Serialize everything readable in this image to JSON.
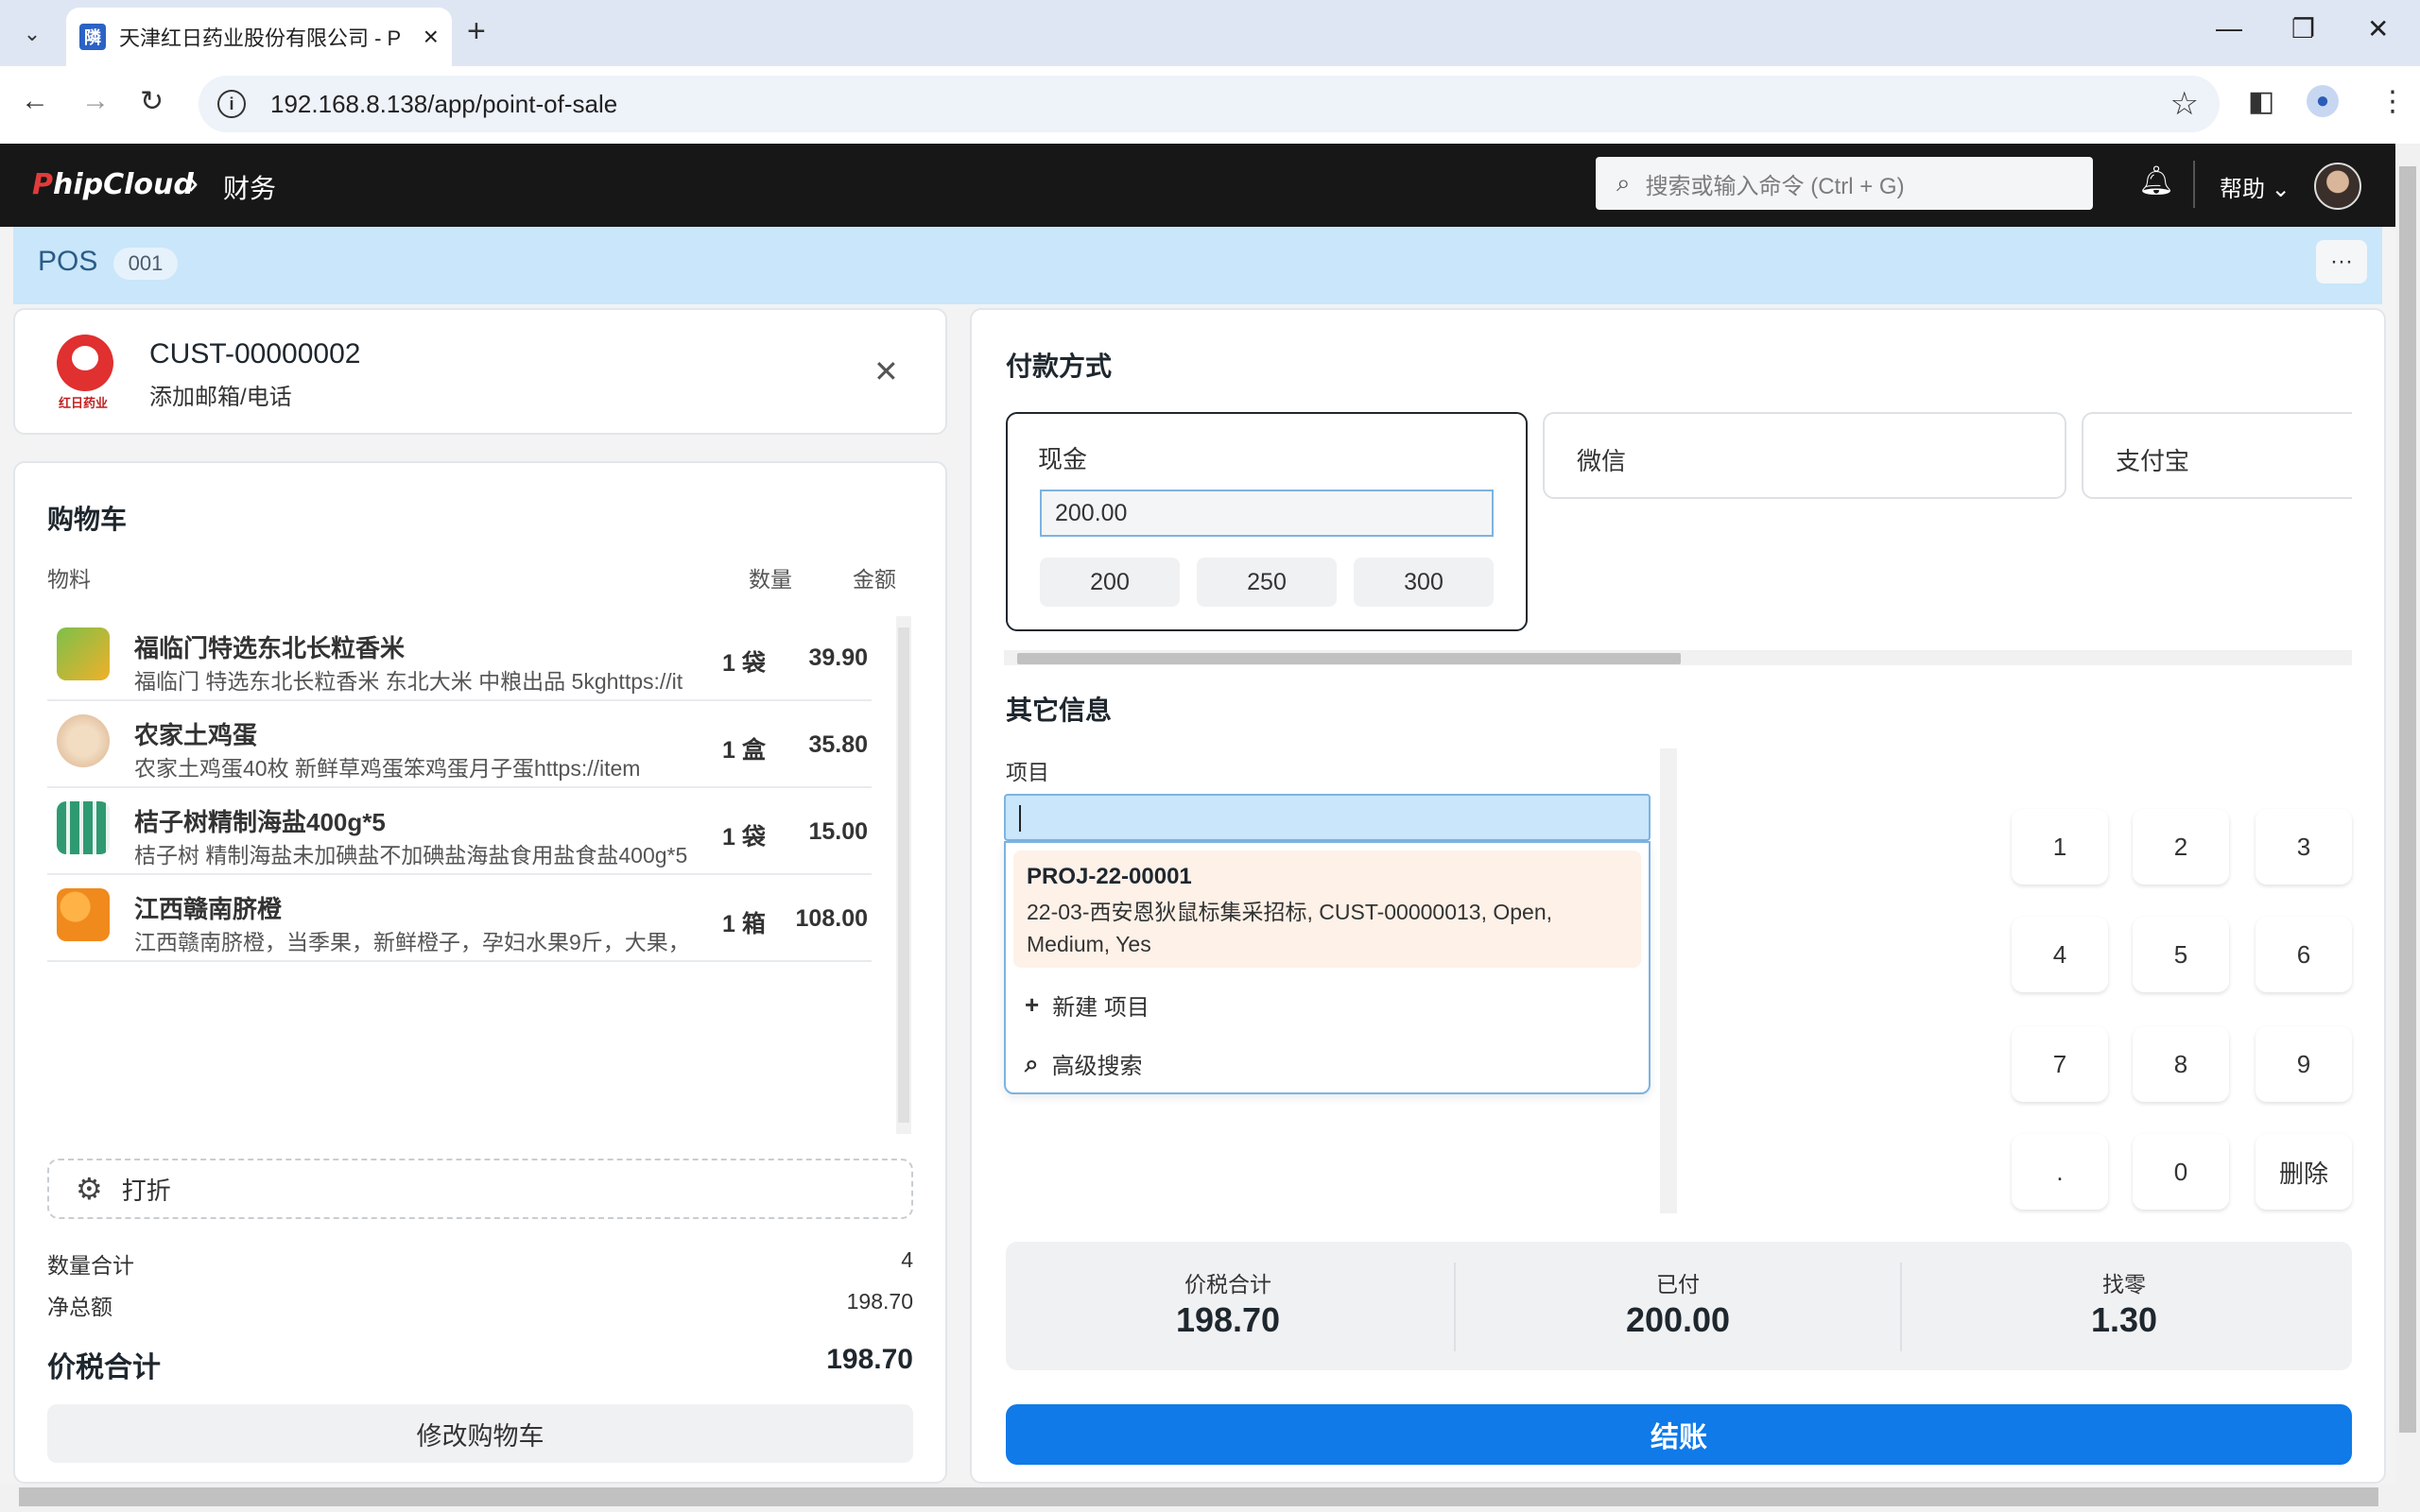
{
  "browser": {
    "tab_title": "天津红日药业股份有限公司 - P",
    "tab_favicon": "隣",
    "url": "192.168.8.138/app/point-of-sale"
  },
  "navbar": {
    "logo": "PhipCloud",
    "breadcrumb": "财务",
    "search_placeholder": "搜索或输入命令 (Ctrl + G)",
    "help_label": "帮助"
  },
  "pos": {
    "title": "POS",
    "badge": "001"
  },
  "customer": {
    "id": "CUST-00000002",
    "subtitle": "添加邮箱/电话",
    "logo_text": "红日药业"
  },
  "cart": {
    "title": "购物车",
    "col_item": "物料",
    "col_qty": "数量",
    "col_amount": "金额",
    "items": [
      {
        "name": "福临门特选东北长粒香米",
        "desc": "福临门 特选东北长粒香米 东北大米 中粮出品 5kghttps://it",
        "qty": "1 袋",
        "amount": "39.90",
        "thumb_color": "#7cc04a"
      },
      {
        "name": "农家土鸡蛋",
        "desc": "农家土鸡蛋40枚 新鲜草鸡蛋笨鸡蛋月子蛋https://item",
        "qty": "1 盒",
        "amount": "35.80",
        "thumb_color": "#e8c9a6"
      },
      {
        "name": "桔子树精制海盐400g*5",
        "desc": "桔子树 精制海盐未加碘盐不加碘盐海盐食用盐食盐400g*5",
        "qty": "1 袋",
        "amount": "15.00",
        "thumb_color": "#3aa57a"
      },
      {
        "name": "江西赣南脐橙",
        "desc": "江西赣南脐橙，当季果，新鲜橙子，孕妇水果9斤，大果，",
        "qty": "1 箱",
        "amount": "108.00",
        "thumb_color": "#f08a1c"
      }
    ],
    "discount_label": "打折",
    "total_qty_label": "数量合计",
    "total_qty": "4",
    "net_total_label": "净总额",
    "net_total": "198.70",
    "grand_total_label": "价税合计",
    "grand_total": "198.70",
    "edit_cart_label": "修改购物车"
  },
  "payment": {
    "title": "付款方式",
    "methods": [
      {
        "label": "现金",
        "amount": "200.00",
        "quick": [
          "200",
          "250",
          "300"
        ]
      },
      {
        "label": "微信"
      },
      {
        "label": "支付宝"
      }
    ]
  },
  "other_info": {
    "title": "其它信息",
    "project_label": "项目",
    "dropdown": {
      "item_title": "PROJ-22-00001",
      "item_desc": "22-03-西安恩狄鼠标集采招标, CUST-00000013, Open, Medium, Yes",
      "new_label": "新建 项目",
      "advanced_label": "高级搜索"
    }
  },
  "numpad": [
    "1",
    "2",
    "3",
    "4",
    "5",
    "6",
    "7",
    "8",
    "9",
    ".",
    "0",
    "删除"
  ],
  "totals": {
    "grand_label": "价税合计",
    "grand_value": "198.70",
    "paid_label": "已付",
    "paid_value": "200.00",
    "change_label": "找零",
    "change_value": "1.30"
  },
  "checkout_label": "结账",
  "colors": {
    "accent": "#0f7ae8",
    "pos_band": "#c9e6fb",
    "navbar": "#171717",
    "dropdown_highlight": "#fdf1e8"
  }
}
